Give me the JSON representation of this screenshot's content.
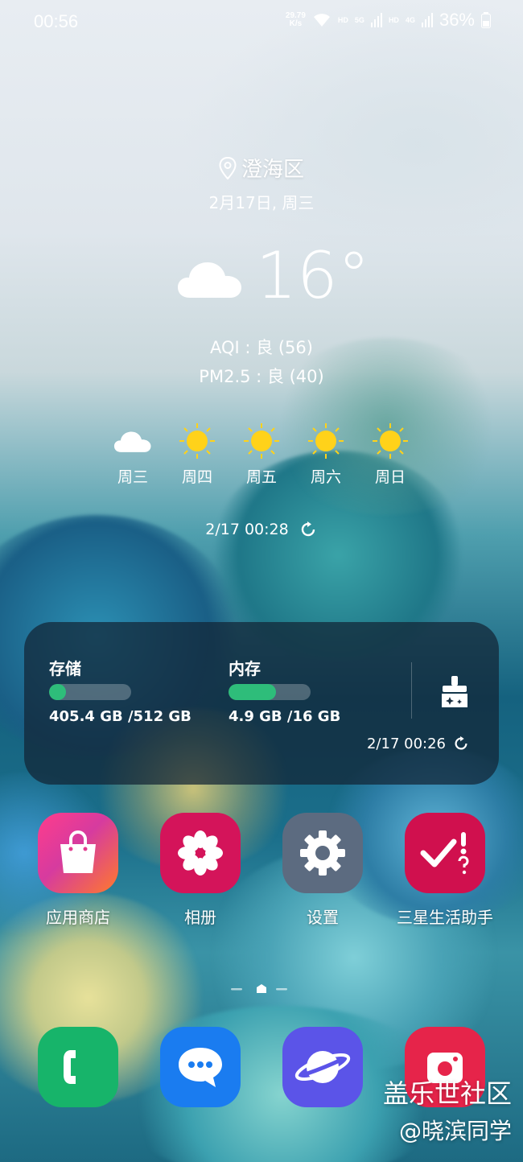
{
  "status_bar": {
    "time": "00:56",
    "speed_value": "29.79",
    "speed_unit": "K/s",
    "hd1": "HD",
    "net1": "5G",
    "hd2": "HD",
    "net2": "4G",
    "battery": "36%"
  },
  "weather": {
    "location": "澄海区",
    "date": "2月17日, 周三",
    "temperature": "16°",
    "condition_icon": "cloud-icon",
    "aqi": "AQI : 良 (56)",
    "pm25": "PM2.5 : 良 (40)",
    "forecast": [
      {
        "day": "周三",
        "icon": "cloud-icon"
      },
      {
        "day": "周四",
        "icon": "sun-icon"
      },
      {
        "day": "周五",
        "icon": "sun-icon"
      },
      {
        "day": "周六",
        "icon": "sun-icon"
      },
      {
        "day": "周日",
        "icon": "sun-icon"
      }
    ],
    "updated": "2/17 00:28"
  },
  "device_care": {
    "storage_label": "存储",
    "storage_value": "405.4 GB /512 GB",
    "storage_used_fraction": 0.21,
    "memory_label": "内存",
    "memory_value": "4.9 GB /16 GB",
    "memory_used_fraction": 0.58,
    "updated": "2/17 00:26",
    "bar_color": "#2ebd7a"
  },
  "apps": [
    {
      "name": "应用商店",
      "icon": "shopping-bag-icon"
    },
    {
      "name": "相册",
      "icon": "flower-icon"
    },
    {
      "name": "设置",
      "icon": "gear-icon"
    },
    {
      "name": "三星生活助手",
      "icon": "check-help-icon"
    }
  ],
  "dock": [
    {
      "icon": "phone-icon"
    },
    {
      "icon": "message-icon"
    },
    {
      "icon": "planet-icon"
    },
    {
      "icon": "camera-icon"
    }
  ],
  "watermark": {
    "line1": "盖乐世社区",
    "line2": "@晓滨同学"
  }
}
